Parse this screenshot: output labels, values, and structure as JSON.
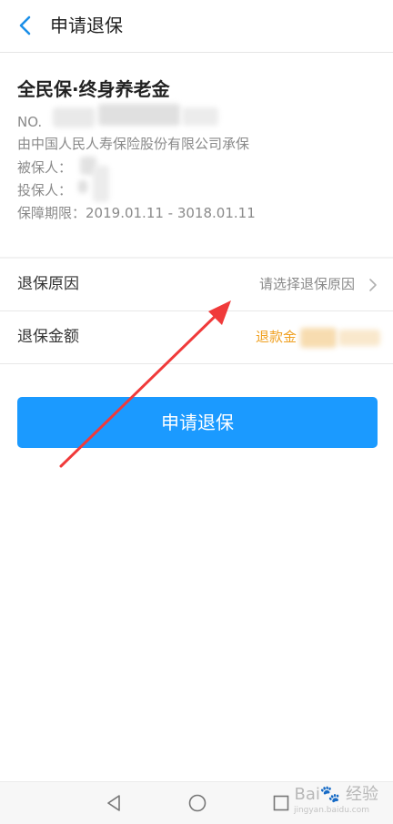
{
  "header": {
    "title": "申请退保"
  },
  "policy": {
    "product_name": "全民保·终身养老金",
    "no_label": "NO.",
    "insurer": "由中国人民人寿保险股份有限公司承保",
    "insured_label": "被保人：",
    "applicant_label": "投保人：",
    "period_label": "保障期限：",
    "period_value": "2019.01.11 - 3018.01.11"
  },
  "form": {
    "reason_label": "退保原因",
    "reason_placeholder": "请选择退保原因",
    "amount_label": "退保金额",
    "amount_value": "退款金"
  },
  "submit_label": "申请退保",
  "watermark": {
    "text": "Bai🐾 经验",
    "sub": "jingyan.baidu.com"
  },
  "colors": {
    "primary": "#1b9aff",
    "accent": "#f0a020",
    "annotation": "#f03a3a"
  }
}
